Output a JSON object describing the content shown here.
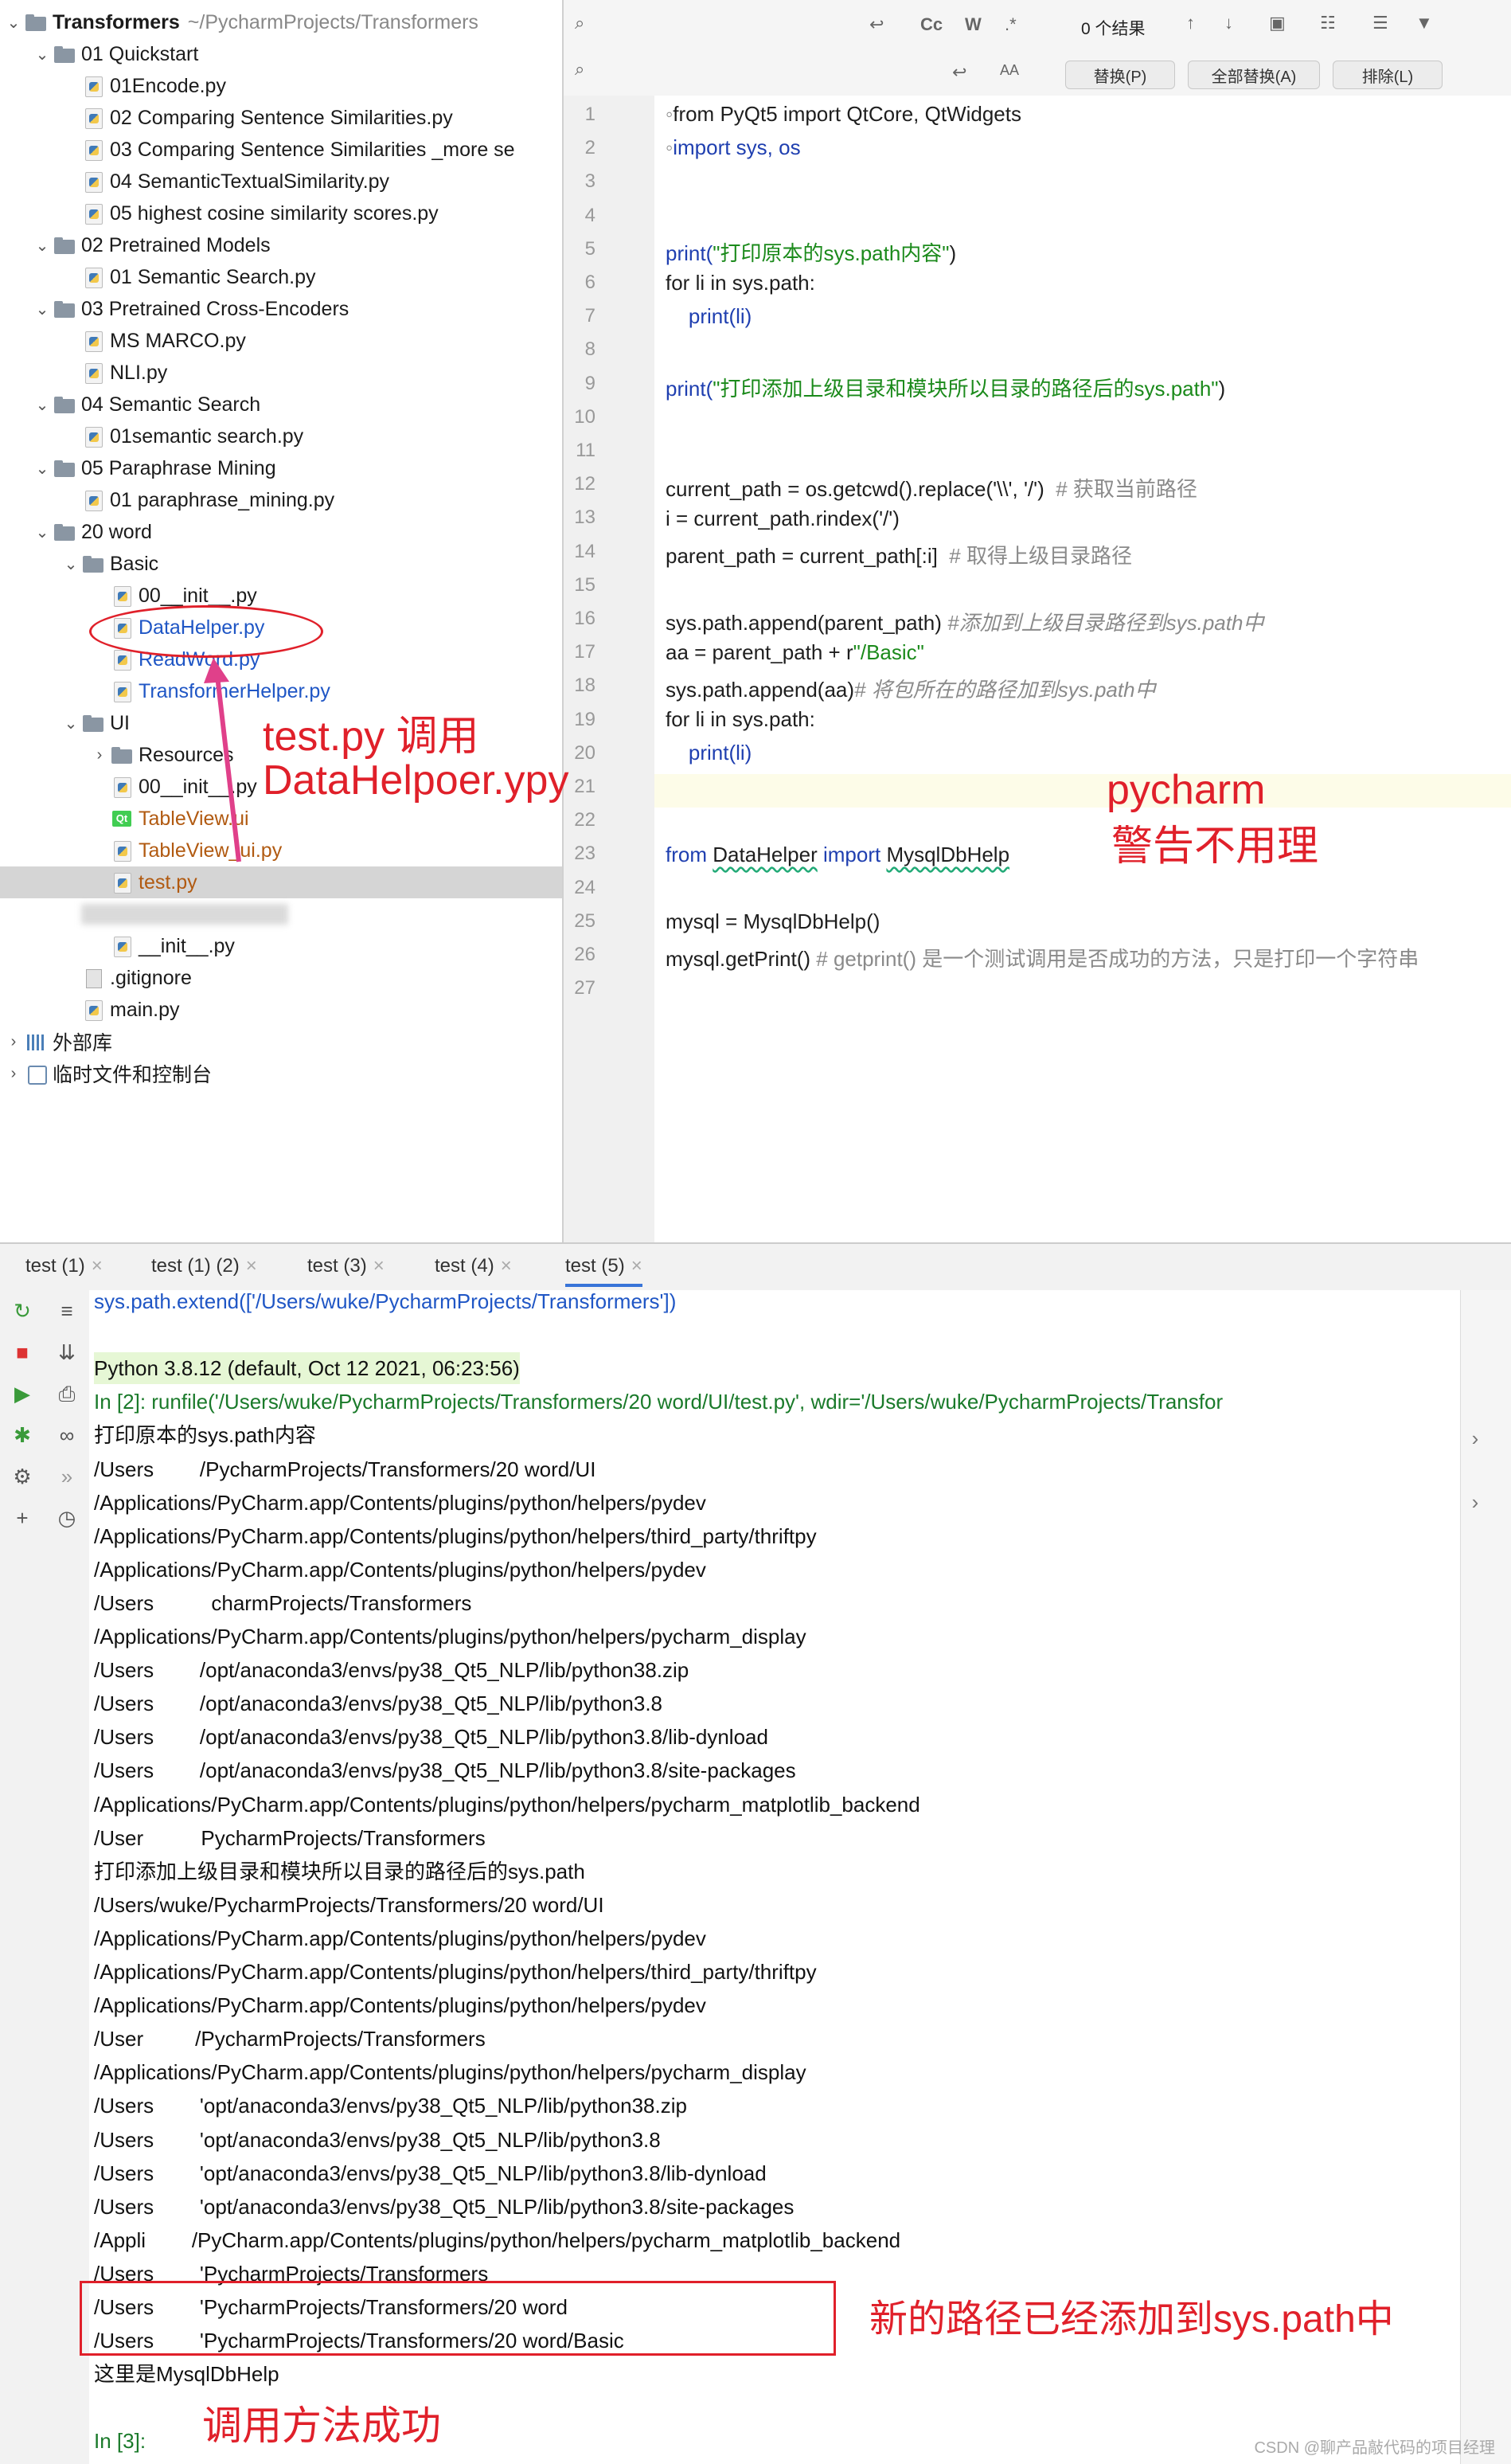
{
  "project": {
    "root_name": "Transformers",
    "root_path": "~/PycharmProjects/Transformers",
    "items": [
      {
        "label": "01 Quickstart",
        "kind": "folder"
      },
      {
        "label": "01Encode.py",
        "kind": "py"
      },
      {
        "label": "02 Comparing Sentence Similarities.py",
        "kind": "py"
      },
      {
        "label": "03 Comparing Sentence Similarities _more se",
        "kind": "py"
      },
      {
        "label": "04 SemanticTextualSimilarity.py",
        "kind": "py"
      },
      {
        "label": "05 highest cosine similarity scores.py",
        "kind": "py"
      },
      {
        "label": "02 Pretrained Models",
        "kind": "folder"
      },
      {
        "label": "01 Semantic Search.py",
        "kind": "py"
      },
      {
        "label": "03 Pretrained Cross-Encoders",
        "kind": "folder"
      },
      {
        "label": "MS MARCO.py",
        "kind": "py"
      },
      {
        "label": "NLI.py",
        "kind": "py"
      },
      {
        "label": "04 Semantic Search",
        "kind": "folder"
      },
      {
        "label": "01semantic search.py",
        "kind": "py"
      },
      {
        "label": "05 Paraphrase Mining",
        "kind": "folder"
      },
      {
        "label": "01 paraphrase_mining.py",
        "kind": "py"
      },
      {
        "label": "20 word",
        "kind": "folder"
      },
      {
        "label": "Basic",
        "kind": "folder"
      },
      {
        "label": "00__init__.py",
        "kind": "py"
      },
      {
        "label": "DataHelper.py",
        "kind": "py"
      },
      {
        "label": "ReadWord.py",
        "kind": "py"
      },
      {
        "label": "TransformerHelper.py",
        "kind": "py"
      },
      {
        "label": "UI",
        "kind": "folder"
      },
      {
        "label": "Resources",
        "kind": "folder"
      },
      {
        "label": "00__init__.py",
        "kind": "py"
      },
      {
        "label": "TableView.ui",
        "kind": "ui"
      },
      {
        "label": "TableView_ui.py",
        "kind": "py"
      },
      {
        "label": "test.py",
        "kind": "py"
      },
      {
        "label": "",
        "kind": "blurred"
      },
      {
        "label": "__init__.py",
        "kind": "py"
      },
      {
        "label": ".gitignore",
        "kind": "git"
      },
      {
        "label": "main.py",
        "kind": "py"
      },
      {
        "label": "外部库",
        "kind": "lib"
      },
      {
        "label": "临时文件和控制台",
        "kind": "scratch"
      }
    ]
  },
  "search": {
    "results": "0 个结果",
    "case_label": "Cc",
    "word_label": "W",
    "regex_label": ".*",
    "replace_button": "替换(P)",
    "replace_all_button": "全部替换(A)",
    "exclude_button": "排除(L)"
  },
  "editor": {
    "line_numbers": [
      "1",
      "2",
      "3",
      "4",
      "5",
      "6",
      "7",
      "8",
      "9",
      "10",
      "11",
      "12",
      "13",
      "14",
      "15",
      "16",
      "17",
      "18",
      "19",
      "20",
      "21",
      "22",
      "23",
      "24",
      "25",
      "26",
      "27"
    ],
    "lines": {
      "l1": "from PyQt5 import QtCore, QtWidgets",
      "l2": "import sys, os",
      "l5_a": "print(",
      "l5_b": "\"打印原本的sys.path内容\"",
      "l5_c": ")",
      "l6": "for li in sys.path:",
      "l7": "    print(li)",
      "l9_a": "print(",
      "l9_b": "\"打印添加上级目录和模块所以目录的路径后的sys.path\"",
      "l9_c": ")",
      "l12_a": "current_path = os.getcwd().replace('\\\\', '/')",
      "l12_b": "  # 获取当前路径",
      "l13": "i = current_path.rindex('/')",
      "l14_a": "parent_path = current_path[:i]",
      "l14_b": "  # 取得上级目录路径",
      "l16_a": "sys.path.append(parent_path)",
      "l16_b": " #添加到上级目录路径到sys.path中",
      "l17_a": "aa = parent_path + r",
      "l17_b": "\"/Basic\"",
      "l18_a": "sys.path.append(aa)",
      "l18_b": "# 将包所在的路径加到sys.path中",
      "l19": "for li in sys.path:",
      "l20": "    print(li)",
      "l23_a": "from ",
      "l23_b": "DataHelper",
      "l23_c": " import ",
      "l23_d": "MysqlDbHelp",
      "l25": "mysql = MysqlDbHelp()",
      "l26_a": "mysql.getPrint()",
      "l26_b": " # getprint() 是一个测试调用是否成功的方法，只是打印一个字符串"
    }
  },
  "tabs": [
    "test (1)",
    "test (1) (2)",
    "test (3)",
    "test (4)",
    "test (5)"
  ],
  "active_tab": "test (5)",
  "console": {
    "lines": [
      "sys.path.extend(['/Users/wuke/PycharmProjects/Transformers'])",
      "",
      "Python 3.8.12 (default, Oct 12 2021, 06:23:56)",
      "In [2]: runfile('/Users/wuke/PycharmProjects/Transformers/20 word/UI/test.py', wdir='/Users/wuke/PycharmProjects/Transfor",
      "打印原本的sys.path内容",
      "/Users        /PycharmProjects/Transformers/20 word/UI",
      "/Applications/PyCharm.app/Contents/plugins/python/helpers/pydev",
      "/Applications/PyCharm.app/Contents/plugins/python/helpers/third_party/thriftpy",
      "/Applications/PyCharm.app/Contents/plugins/python/helpers/pydev",
      "/Users          charmProjects/Transformers",
      "/Applications/PyCharm.app/Contents/plugins/python/helpers/pycharm_display",
      "/Users        /opt/anaconda3/envs/py38_Qt5_NLP/lib/python38.zip",
      "/Users        /opt/anaconda3/envs/py38_Qt5_NLP/lib/python3.8",
      "/Users        /opt/anaconda3/envs/py38_Qt5_NLP/lib/python3.8/lib-dynload",
      "/Users        /opt/anaconda3/envs/py38_Qt5_NLP/lib/python3.8/site-packages",
      "/Applications/PyCharm.app/Contents/plugins/python/helpers/pycharm_matplotlib_backend",
      "/User          PycharmProjects/Transformers",
      "打印添加上级目录和模块所以目录的路径后的sys.path",
      "/Users/wuke/PycharmProjects/Transformers/20 word/UI",
      "/Applications/PyCharm.app/Contents/plugins/python/helpers/pydev",
      "/Applications/PyCharm.app/Contents/plugins/python/helpers/third_party/thriftpy",
      "/Applications/PyCharm.app/Contents/plugins/python/helpers/pydev",
      "/User         /PycharmProjects/Transformers",
      "/Applications/PyCharm.app/Contents/plugins/python/helpers/pycharm_display",
      "/Users        'opt/anaconda3/envs/py38_Qt5_NLP/lib/python38.zip",
      "/Users        'opt/anaconda3/envs/py38_Qt5_NLP/lib/python3.8",
      "/Users        'opt/anaconda3/envs/py38_Qt5_NLP/lib/python3.8/lib-dynload",
      "/Users        'opt/anaconda3/envs/py38_Qt5_NLP/lib/python3.8/site-packages",
      "/Appli        /PyCharm.app/Contents/plugins/python/helpers/pycharm_matplotlib_backend",
      "/Users        'PycharmProjects/Transformers",
      "/Users        'PycharmProjects/Transformers/20 word",
      "/Users        'PycharmProjects/Transformers/20 word/Basic",
      "这里是MysqlDbHelp",
      "",
      "In [3]:"
    ]
  },
  "annotations": {
    "test_calls": "test.py 调用",
    "datahelper": "DataHelpoer.ypy",
    "pycharm_warn_1": "pycharm",
    "pycharm_warn_2": "警告不用理",
    "path_added": "新的路径已经添加到sys.path中",
    "call_success": "调用方法成功"
  },
  "watermark": "CSDN @聊产品敲代码的项目经理",
  "colors": {
    "annotation": "#e0202a",
    "accent": "#3874d8",
    "keyword": "#1f3fb0",
    "string": "#1b8a1b"
  }
}
